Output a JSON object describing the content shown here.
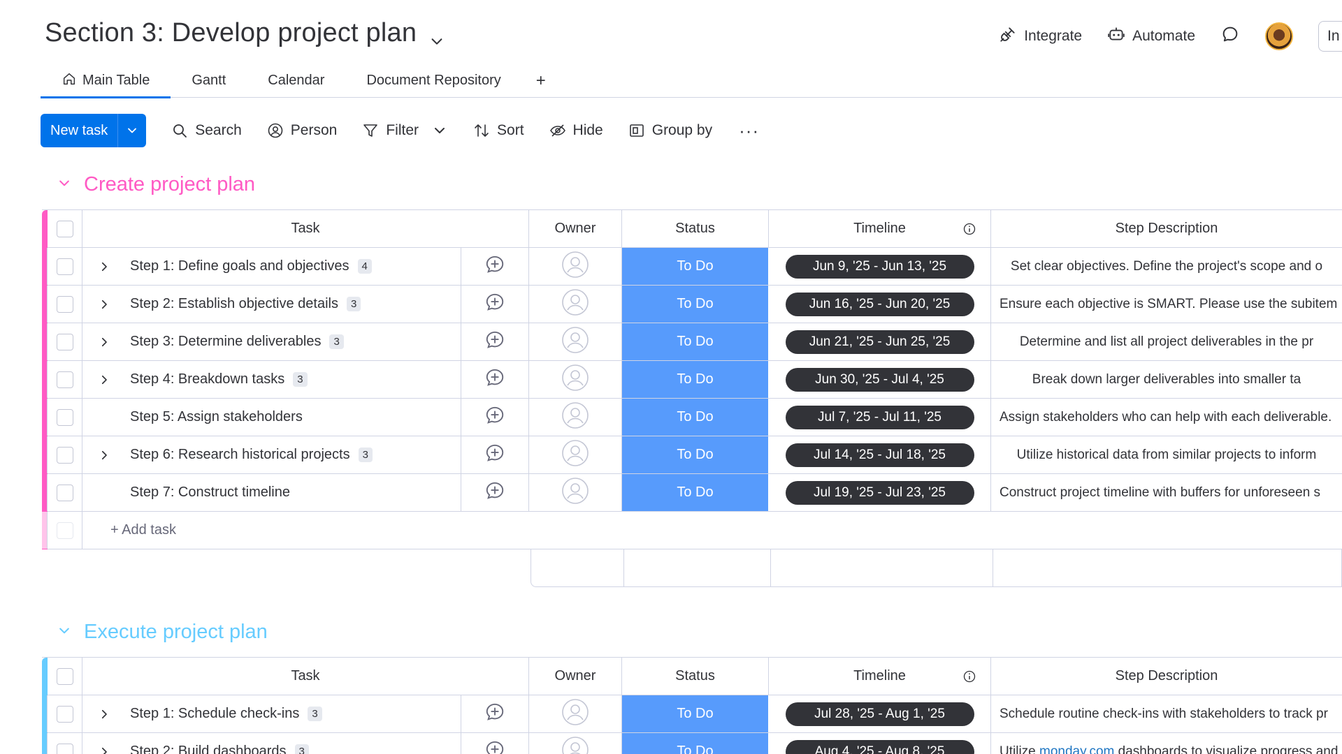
{
  "header": {
    "title": "Section 3: Develop project plan",
    "integrate": "Integrate",
    "automate": "Automate",
    "invite": "In"
  },
  "tabs": [
    {
      "label": "Main Table"
    },
    {
      "label": "Gantt"
    },
    {
      "label": "Calendar"
    },
    {
      "label": "Document Repository"
    }
  ],
  "tab_add": "+",
  "toolbar": {
    "new_task": "New task",
    "search": "Search",
    "person": "Person",
    "filter": "Filter",
    "sort": "Sort",
    "hide": "Hide",
    "group_by": "Group by",
    "more": "···"
  },
  "columns": {
    "task": "Task",
    "owner": "Owner",
    "status": "Status",
    "timeline": "Timeline",
    "description": "Step Description"
  },
  "colors": {
    "group1": "#ff5ac4",
    "group2": "#66ccff",
    "status_todo": "#579bfc",
    "accent": "#0073ea"
  },
  "groups": [
    {
      "title": "Create project plan",
      "rows": [
        {
          "task": "Step 1: Define goals and objectives",
          "sub": "4",
          "status": "To Do",
          "timeline": "Jun 9, '25 - Jun 13, '25",
          "desc": "Set clear objectives. Define the project's scope and o"
        },
        {
          "task": "Step 2: Establish objective details",
          "sub": "3",
          "status": "To Do",
          "timeline": "Jun 16, '25 - Jun 20, '25",
          "desc": "Ensure each objective is SMART. Please use the subitem"
        },
        {
          "task": "Step 3: Determine deliverables",
          "sub": "3",
          "status": "To Do",
          "timeline": "Jun 21, '25 - Jun 25, '25",
          "desc": "Determine and list all project deliverables in the pr"
        },
        {
          "task": "Step 4: Breakdown tasks",
          "sub": "3",
          "status": "To Do",
          "timeline": "Jun 30, '25 - Jul 4, '25",
          "desc": "Break down larger deliverables into smaller ta"
        },
        {
          "task": "Step 5: Assign stakeholders",
          "sub": "",
          "status": "To Do",
          "timeline": "Jul 7, '25 - Jul 11, '25",
          "desc": "Assign stakeholders who can help with each deliverable."
        },
        {
          "task": "Step 6: Research historical projects",
          "sub": "3",
          "status": "To Do",
          "timeline": "Jul 14, '25 - Jul 18, '25",
          "desc": "Utilize historical data from similar projects to inform"
        },
        {
          "task": "Step 7: Construct timeline",
          "sub": "",
          "status": "To Do",
          "timeline": "Jul 19, '25 - Jul 23, '25",
          "desc": "Construct project timeline with buffers for unforeseen s"
        }
      ],
      "add_task": "+ Add task"
    },
    {
      "title": "Execute project plan",
      "rows": [
        {
          "task": "Step 1: Schedule check-ins",
          "sub": "3",
          "status": "To Do",
          "timeline": "Jul 28, '25 - Aug 1, '25",
          "desc": "Schedule routine check-ins with stakeholders to track pr"
        },
        {
          "task": "Step 2: Build dashboards",
          "sub": "3",
          "status": "To Do",
          "timeline": "Aug 4, '25 - Aug 8, '25",
          "desc_pre": "Utilize ",
          "desc_link": "monday.com",
          "desc_post": " dashboards to visualize progress and"
        }
      ]
    }
  ]
}
